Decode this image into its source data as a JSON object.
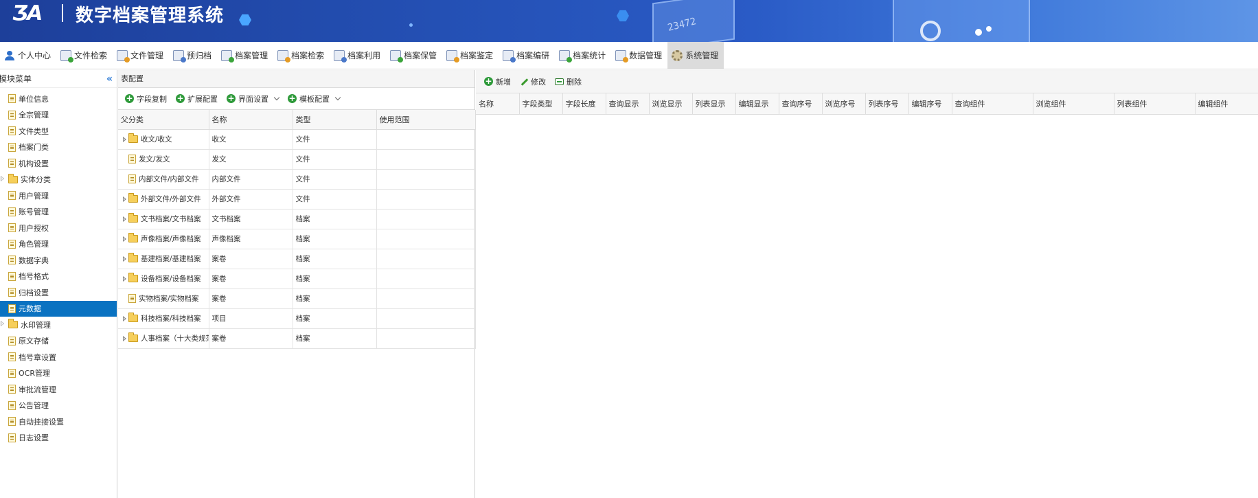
{
  "header": {
    "logo": "ƷA",
    "title": "数字档案管理系统",
    "deco_number": "23472"
  },
  "nav": [
    {
      "label": "个人中心",
      "icon": "user-icon"
    },
    {
      "label": "文件检索",
      "icon": "search-doc-icon"
    },
    {
      "label": "文件管理",
      "icon": "file-manage-icon"
    },
    {
      "label": "预归档",
      "icon": "pre-archive-icon"
    },
    {
      "label": "档案管理",
      "icon": "archive-manage-icon"
    },
    {
      "label": "档案检索",
      "icon": "archive-search-icon"
    },
    {
      "label": "档案利用",
      "icon": "archive-use-icon"
    },
    {
      "label": "档案保管",
      "icon": "archive-keep-icon"
    },
    {
      "label": "档案鉴定",
      "icon": "archive-appraise-icon"
    },
    {
      "label": "档案编研",
      "icon": "archive-compile-icon"
    },
    {
      "label": "档案统计",
      "icon": "archive-stats-icon"
    },
    {
      "label": "数据管理",
      "icon": "data-manage-icon"
    },
    {
      "label": "系统管理",
      "icon": "gear-icon",
      "active": true
    }
  ],
  "sidebar": {
    "title": "模块菜单",
    "items": [
      {
        "label": "单位信息",
        "type": "file"
      },
      {
        "label": "全宗管理",
        "type": "file"
      },
      {
        "label": "文件类型",
        "type": "file"
      },
      {
        "label": "档案门类",
        "type": "file"
      },
      {
        "label": "机构设置",
        "type": "file"
      },
      {
        "label": "实体分类",
        "type": "folder",
        "expandable": true
      },
      {
        "label": "用户管理",
        "type": "file"
      },
      {
        "label": "账号管理",
        "type": "file"
      },
      {
        "label": "用户授权",
        "type": "file"
      },
      {
        "label": "角色管理",
        "type": "file"
      },
      {
        "label": "数据字典",
        "type": "file"
      },
      {
        "label": "档号格式",
        "type": "file"
      },
      {
        "label": "归档设置",
        "type": "file"
      },
      {
        "label": "元数据",
        "type": "file",
        "selected": true
      },
      {
        "label": "水印管理",
        "type": "folder",
        "expandable": true
      },
      {
        "label": "原文存储",
        "type": "file"
      },
      {
        "label": "档号章设置",
        "type": "file"
      },
      {
        "label": "OCR管理",
        "type": "file"
      },
      {
        "label": "审批流管理",
        "type": "file"
      },
      {
        "label": "公告管理",
        "type": "file"
      },
      {
        "label": "自动挂接设置",
        "type": "file"
      },
      {
        "label": "日志设置",
        "type": "file"
      }
    ]
  },
  "table_config": {
    "title": "表配置",
    "toolbar": [
      {
        "label": "字段复制",
        "dropdown": false
      },
      {
        "label": "扩展配置",
        "dropdown": false
      },
      {
        "label": "界面设置",
        "dropdown": true
      },
      {
        "label": "模板配置",
        "dropdown": true
      }
    ],
    "columns": [
      "父分类",
      "名称",
      "类型",
      "使用范围"
    ],
    "rows": [
      {
        "parent": "收文/收文",
        "name": "收文",
        "type": "文件",
        "scope": "",
        "icon": "folder",
        "expandable": true
      },
      {
        "parent": "发文/发文",
        "name": "发文",
        "type": "文件",
        "scope": "",
        "icon": "file",
        "expandable": false
      },
      {
        "parent": "内部文件/内部文件",
        "name": "内部文件",
        "type": "文件",
        "scope": "",
        "icon": "file",
        "expandable": false
      },
      {
        "parent": "外部文件/外部文件",
        "name": "外部文件",
        "type": "文件",
        "scope": "",
        "icon": "folder",
        "expandable": true
      },
      {
        "parent": "文书档案/文书档案",
        "name": "文书档案",
        "type": "档案",
        "scope": "",
        "icon": "folder",
        "expandable": true
      },
      {
        "parent": "声像档案/声像档案",
        "name": "声像档案",
        "type": "档案",
        "scope": "",
        "icon": "folder",
        "expandable": true
      },
      {
        "parent": "基建档案/基建档案",
        "name": "案卷",
        "type": "档案",
        "scope": "",
        "icon": "folder",
        "expandable": true
      },
      {
        "parent": "设备档案/设备档案",
        "name": "案卷",
        "type": "档案",
        "scope": "",
        "icon": "folder",
        "expandable": true
      },
      {
        "parent": "实物档案/实物档案",
        "name": "案卷",
        "type": "档案",
        "scope": "",
        "icon": "file",
        "expandable": false
      },
      {
        "parent": "科技档案/科技档案",
        "name": "项目",
        "type": "档案",
        "scope": "",
        "icon": "folder",
        "expandable": true
      },
      {
        "parent": "人事档案（十大类规范）",
        "name": "案卷",
        "type": "档案",
        "scope": "",
        "icon": "folder",
        "expandable": true
      }
    ]
  },
  "field_panel": {
    "toolbar": [
      {
        "label": "新增",
        "icon": "add-icon"
      },
      {
        "label": "修改",
        "icon": "edit-icon"
      },
      {
        "label": "删除",
        "icon": "delete-icon"
      }
    ],
    "columns": [
      "名称",
      "字段类型",
      "字段长度",
      "查询显示",
      "浏览显示",
      "列表显示",
      "编辑显示",
      "查询序号",
      "浏览序号",
      "列表序号",
      "编辑序号",
      "查询组件",
      "浏览组件",
      "列表组件",
      "编辑组件"
    ]
  },
  "colors": {
    "header_start": "#1d3f9a",
    "header_end": "#5e95e6",
    "selected_bg": "#0a72c1",
    "accent_green": "#2e9a3a",
    "collapse_blue": "#2b7ad6"
  }
}
